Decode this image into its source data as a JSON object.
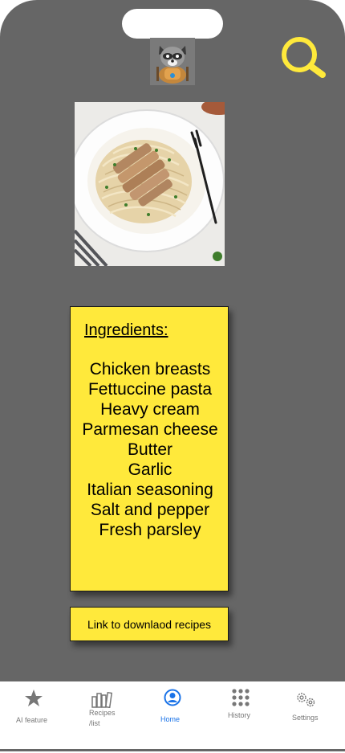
{
  "ingredients": {
    "title": "Ingredients:",
    "items": [
      "Chicken breasts",
      "Fettuccine pasta",
      "Heavy cream",
      "Parmesan cheese",
      "Butter",
      "Garlic",
      "Italian seasoning",
      "Salt and pepper",
      "Fresh parsley"
    ]
  },
  "link_button": "Link to downlaod recipes",
  "nav": {
    "ai": "AI feature",
    "recipes_line1": "Recipes",
    "recipes_line2": "/list",
    "home": "Home",
    "history": "History",
    "settings": "Settings"
  },
  "colors": {
    "background": "#666666",
    "card": "#ffe93b",
    "search_icon": "#ffe93b",
    "active_nav": "#1a73e8",
    "inactive_nav": "#777777"
  },
  "icons": {
    "search": "search-icon",
    "avatar": "raccoon-chef-logo",
    "ai": "star-icon",
    "recipes": "books-icon",
    "home": "user-circle-icon",
    "history": "dots-grid-icon",
    "settings": "gears-icon"
  }
}
